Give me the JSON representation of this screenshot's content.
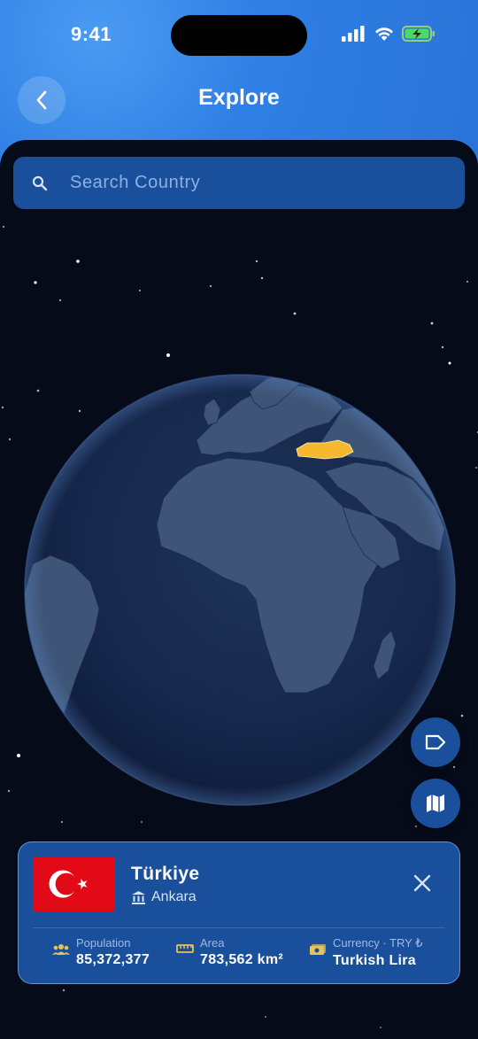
{
  "status_bar": {
    "time": "9:41"
  },
  "header": {
    "title": "Explore"
  },
  "search": {
    "placeholder": "Search Country"
  },
  "country_card": {
    "name": "Türkiye",
    "capital": "Ankara",
    "flag_colors": {
      "red": "#e30a17",
      "white": "#ffffff"
    },
    "stats": [
      {
        "label": "Population",
        "value": "85,372,377",
        "icon": "population-icon"
      },
      {
        "label": "Area",
        "value": "783,562 km²",
        "icon": "ruler-icon"
      },
      {
        "label": "Currency · TRY ₺",
        "value": "Turkish Lira",
        "icon": "currency-icon"
      }
    ]
  },
  "colors": {
    "header_blue": "#2f7fe4",
    "panel_dark": "#060b19",
    "accent_blue": "#1a4f9c",
    "highlight_country": "#f5b82e",
    "stat_icon": "#e8c35a"
  }
}
